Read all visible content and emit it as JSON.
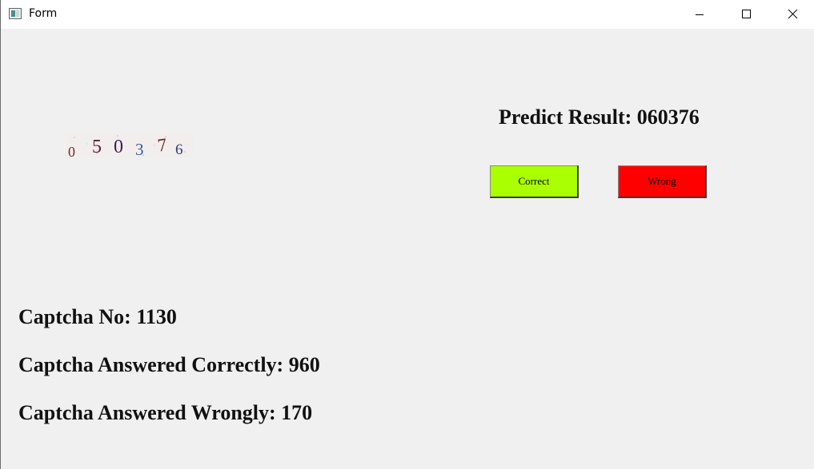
{
  "window": {
    "title": "Form",
    "icon": "form-window-icon",
    "controls": {
      "minimize_icon": "minimize-icon",
      "maximize_icon": "maximize-icon",
      "close_icon": "close-icon"
    }
  },
  "captcha": {
    "digits": [
      "0",
      "5",
      "0",
      "3",
      "7",
      "6"
    ],
    "colors": [
      "#7a2a2a",
      "#5a1f3a",
      "#3a2050",
      "#2e5c9a",
      "#6a1f1f",
      "#2e3a7a"
    ]
  },
  "prediction": {
    "label": "Predict Result:",
    "value": "060376",
    "text": "Predict Result: 060376"
  },
  "buttons": {
    "correct_label": "Correct",
    "correct_color": "#aaff00",
    "wrong_label": "Wrong",
    "wrong_color": "#ff0000"
  },
  "stats": {
    "captcha_no": "Captcha No: 1130",
    "answered_correctly": "Captcha Answered Correctly: 960",
    "answered_wrongly": "Captcha Answered Wrongly: 170"
  },
  "colors": {
    "background": "#f0f0f0",
    "titlebar": "#ffffff"
  }
}
